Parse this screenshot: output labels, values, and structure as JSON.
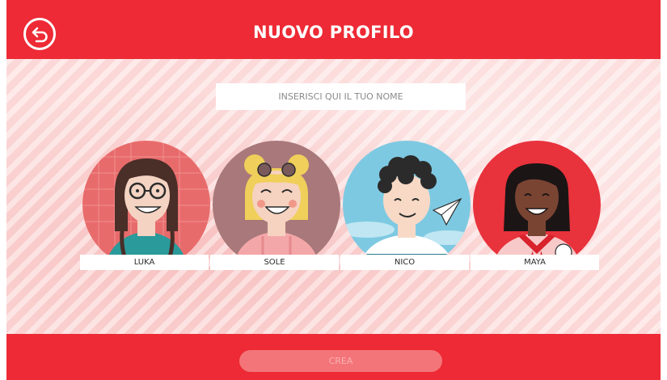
{
  "header": {
    "title": "NUOVO PROFILO",
    "back_icon": "back-arrow-circle-icon"
  },
  "name_input": {
    "placeholder": "INSERISCI QUI IL TUO NOME",
    "value": ""
  },
  "avatars": [
    {
      "label": "LUKA",
      "bg": "#e86b6b",
      "skin": "#f4d3c2",
      "hair": "#4a2e28"
    },
    {
      "label": "SOLE",
      "bg": "#a8787a",
      "skin": "#f6d2c0",
      "hair": "#f0cf5a"
    },
    {
      "label": "NICO",
      "bg": "#7ec9e2",
      "skin": "#f7d9c6",
      "hair": "#2b2b2b"
    },
    {
      "label": "MAYA",
      "bg": "#e8323c",
      "skin": "#7a4433",
      "hair": "#1c1515"
    }
  ],
  "footer": {
    "create_label": "CREA"
  },
  "colors": {
    "brand_red": "#ed2a35",
    "background_pink": "#fbd8d7",
    "disabled_button": "#f37579"
  }
}
